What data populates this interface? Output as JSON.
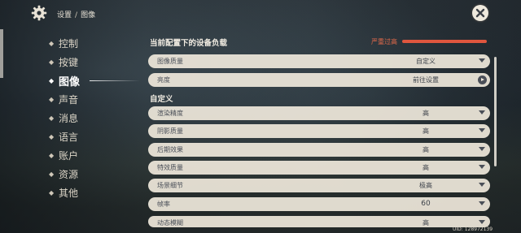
{
  "header": {
    "breadcrumb_root": "设置",
    "breadcrumb_sep": "/",
    "breadcrumb_current": "图像"
  },
  "nav": {
    "items": [
      {
        "label": "控制",
        "active": false
      },
      {
        "label": "按键",
        "active": false
      },
      {
        "label": "图像",
        "active": true
      },
      {
        "label": "声音",
        "active": false
      },
      {
        "label": "消息",
        "active": false
      },
      {
        "label": "语言",
        "active": false
      },
      {
        "label": "账户",
        "active": false
      },
      {
        "label": "资源",
        "active": false
      },
      {
        "label": "其他",
        "active": false
      }
    ]
  },
  "panel": {
    "device_load_title": "当前配置下的设备负载",
    "device_load_status": "严重过高",
    "custom_title": "自定义",
    "top_rows": [
      {
        "label": "图像质量",
        "value": "自定义",
        "control": "dropdown"
      },
      {
        "label": "亮度",
        "value": "前往设置",
        "control": "navigate"
      }
    ],
    "custom_rows": [
      {
        "label": "渲染精度",
        "value": "高",
        "control": "dropdown"
      },
      {
        "label": "阴影质量",
        "value": "高",
        "control": "dropdown"
      },
      {
        "label": "后期效果",
        "value": "高",
        "control": "dropdown"
      },
      {
        "label": "特效质量",
        "value": "高",
        "control": "dropdown"
      },
      {
        "label": "场景细节",
        "value": "极高",
        "control": "dropdown"
      },
      {
        "label": "帧率",
        "value": "60",
        "control": "dropdown"
      },
      {
        "label": "动态模糊",
        "value": "高",
        "control": "dropdown"
      }
    ]
  },
  "footer": {
    "uid": "UID: 128972139"
  },
  "colors": {
    "warning": "#e0563e",
    "row_bg": "#eee7da",
    "text_dark": "#4a4f58"
  },
  "icons": {
    "settings": "gear-icon",
    "close": "close-icon"
  }
}
